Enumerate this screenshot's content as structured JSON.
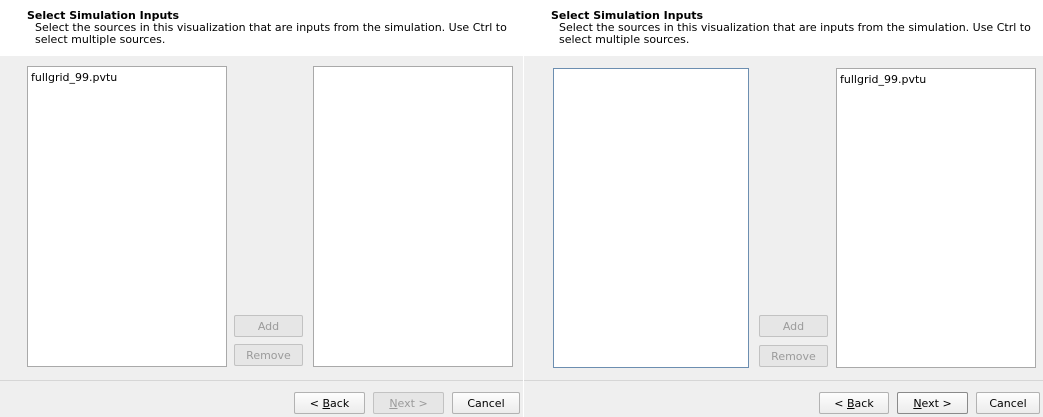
{
  "left": {
    "header": {
      "title": "Select Simulation Inputs",
      "description": "Select the sources in this visualization that are inputs from the simulation. Use Ctrl to select multiple sources."
    },
    "available_sources": [
      "fullgrid_99.pvtu"
    ],
    "selected_sources": [],
    "buttons": {
      "add": "Add",
      "remove": "Remove"
    },
    "footer": {
      "back": {
        "before": "< ",
        "mnemonic": "B",
        "after": "ack"
      },
      "next": {
        "before": "",
        "mnemonic": "N",
        "after": "ext >"
      },
      "cancel": "Cancel"
    }
  },
  "right": {
    "header": {
      "title": "Select Simulation Inputs",
      "description": "Select the sources in this visualization that are inputs from the simulation. Use Ctrl to select multiple sources."
    },
    "available_sources": [],
    "selected_sources": [
      "fullgrid_99.pvtu"
    ],
    "buttons": {
      "add": "Add",
      "remove": "Remove"
    },
    "footer": {
      "back": {
        "before": "< ",
        "mnemonic": "B",
        "after": "ack"
      },
      "next": {
        "before": "",
        "mnemonic": "N",
        "after": "ext >"
      },
      "cancel": "Cancel"
    }
  }
}
